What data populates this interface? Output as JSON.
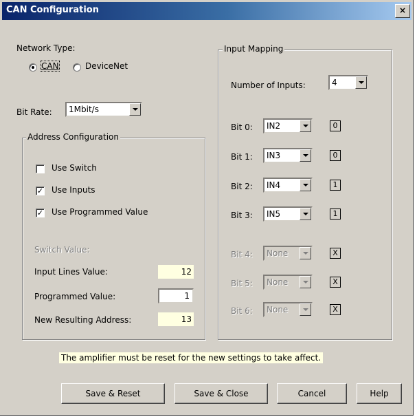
{
  "window": {
    "title": "CAN Configuration",
    "close_glyph": "×"
  },
  "network": {
    "label": "Network Type:",
    "options": [
      {
        "label": "CAN",
        "selected": true
      },
      {
        "label": "DeviceNet",
        "selected": false
      }
    ]
  },
  "bitrate": {
    "label": "Bit Rate:",
    "value": "1Mbit/s"
  },
  "address": {
    "title": "Address Configuration",
    "checks": [
      {
        "label": "Use Switch",
        "checked": false
      },
      {
        "label": "Use Inputs",
        "checked": true
      },
      {
        "label": "Use Programmed Value",
        "checked": true
      }
    ],
    "switch_label": "Switch Value:",
    "input_lines_label": "Input Lines Value:",
    "input_lines_value": "12",
    "programmed_label": "Programmed Value:",
    "programmed_value": "1",
    "resulting_label": "New Resulting Address:",
    "resulting_value": "13"
  },
  "mapping": {
    "title": "Input Mapping",
    "num_label": "Number of Inputs:",
    "num_value": "4",
    "bits": [
      {
        "label": "Bit 0:",
        "value": "IN2",
        "state": "0",
        "enabled": true
      },
      {
        "label": "Bit 1:",
        "value": "IN3",
        "state": "0",
        "enabled": true
      },
      {
        "label": "Bit 2:",
        "value": "IN4",
        "state": "1",
        "enabled": true
      },
      {
        "label": "Bit 3:",
        "value": "IN5",
        "state": "1",
        "enabled": true
      },
      {
        "label": "Bit 4:",
        "value": "None",
        "state": "X",
        "enabled": false
      },
      {
        "label": "Bit 5:",
        "value": "None",
        "state": "X",
        "enabled": false
      },
      {
        "label": "Bit 6:",
        "value": "None",
        "state": "X",
        "enabled": false
      }
    ]
  },
  "notice": "The amplifier must be reset for the new settings to take affect.",
  "buttons": {
    "save_reset": "Save & Reset",
    "save_close": "Save & Close",
    "cancel": "Cancel",
    "help": "Help"
  },
  "check_glyph": "✓"
}
